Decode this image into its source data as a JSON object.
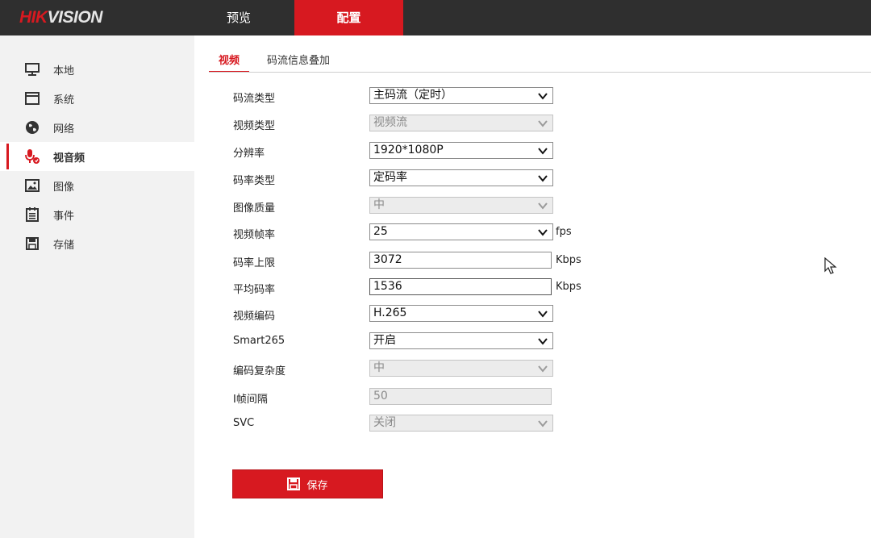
{
  "header": {
    "logo_red": "HIK",
    "logo_rest": "VISION",
    "tabs": [
      {
        "label": "预览"
      },
      {
        "label": "配置"
      }
    ]
  },
  "sidebar": {
    "items": [
      {
        "label": "本地",
        "icon": "monitor-icon"
      },
      {
        "label": "系统",
        "icon": "window-icon"
      },
      {
        "label": "网络",
        "icon": "globe-icon"
      },
      {
        "label": "视音频",
        "icon": "microphone-icon"
      },
      {
        "label": "图像",
        "icon": "image-icon"
      },
      {
        "label": "事件",
        "icon": "calendar-icon"
      },
      {
        "label": "存储",
        "icon": "floppy-icon"
      }
    ],
    "active_index": 3
  },
  "tabs": [
    {
      "label": "视频"
    },
    {
      "label": "码流信息叠加"
    }
  ],
  "form": {
    "stream_type": {
      "label": "码流类型",
      "value": "主码流（定时）"
    },
    "video_type": {
      "label": "视频类型",
      "value": "视频流"
    },
    "resolution": {
      "label": "分辨率",
      "value": "1920*1080P"
    },
    "bitrate_type": {
      "label": "码率类型",
      "value": "定码率"
    },
    "image_quality": {
      "label": "图像质量",
      "value": "中"
    },
    "frame_rate": {
      "label": "视频帧率",
      "value": "25",
      "unit": "fps"
    },
    "max_bitrate": {
      "label": "码率上限",
      "value": "3072",
      "unit": "Kbps"
    },
    "avg_bitrate": {
      "label": "平均码率",
      "value": "1536",
      "unit": "Kbps"
    },
    "video_encoding": {
      "label": "视频编码",
      "value": "H.265"
    },
    "smart265": {
      "label": "Smart265",
      "value": "开启"
    },
    "encoding_complexity": {
      "label": "编码复杂度",
      "value": "中"
    },
    "i_frame_interval": {
      "label": "I帧间隔",
      "value": "50"
    },
    "svc": {
      "label": "SVC",
      "value": "关闭"
    }
  },
  "save_label": "保存",
  "colors": {
    "brand_red": "#d71920",
    "topbar": "#2f2f2f",
    "sidebar": "#f2f2f2"
  }
}
